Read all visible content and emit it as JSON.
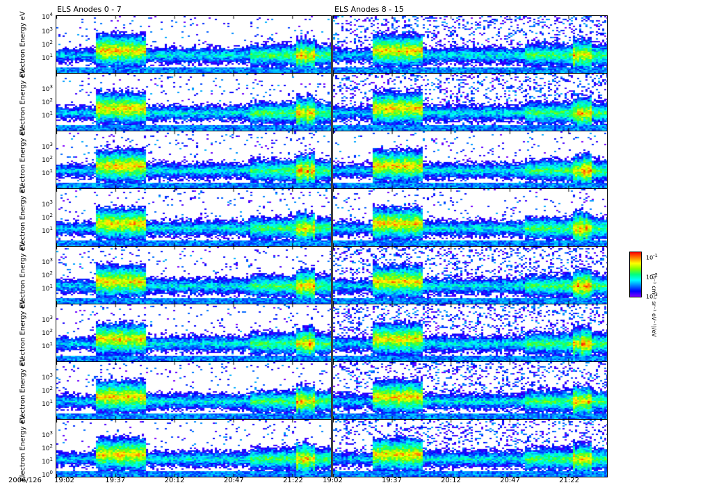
{
  "chart_data": {
    "type": "heatmap",
    "titles": [
      "ELS Anodes 0 - 7",
      "ELS Anodes 8 - 15"
    ],
    "ylabel": "Electron Energy eV",
    "y_scale": "log",
    "ylim": [
      1,
      10000
    ],
    "y_tick_labels": {
      "top": "10",
      "top_exp": "4",
      "b3": "10",
      "b3_exp": "3",
      "b2": "10",
      "b2_exp": "2",
      "b1": "10",
      "b1_exp": "1",
      "bottom": "10",
      "bottom_exp": "0"
    },
    "date_label": "2006/126",
    "x_tick_labels": [
      "19:02",
      "19:37",
      "20:12",
      "20:47",
      "21:22"
    ],
    "xlim": [
      "19:02",
      "21:45"
    ],
    "rows": 8,
    "columns": 2,
    "colorbar": {
      "label": "(s⁻¹ cm⁻² sr⁻¹ eV⁻¹)/eV",
      "ticks": [
        {
          "base": "10",
          "exp": "-1"
        },
        {
          "base": "10",
          "exp": "-2"
        },
        {
          "base": "10",
          "exp": "-3"
        }
      ],
      "colors": [
        "#ff0000",
        "#ffff00",
        "#00ff80",
        "#00ffff",
        "#0000ff",
        "#8000ff"
      ]
    }
  }
}
